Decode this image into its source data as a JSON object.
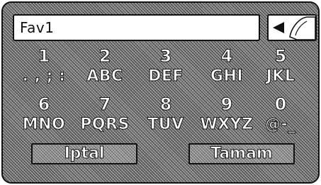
{
  "input": {
    "value": "Fav1"
  },
  "keypad": {
    "row1": [
      {
        "digit": "1",
        "letters": ". , ; :"
      },
      {
        "digit": "2",
        "letters": "ABC"
      },
      {
        "digit": "3",
        "letters": "DEF"
      },
      {
        "digit": "4",
        "letters": "GHI"
      },
      {
        "digit": "5",
        "letters": "JKL"
      }
    ],
    "row2": [
      {
        "digit": "6",
        "letters": "MNO"
      },
      {
        "digit": "7",
        "letters": "PQRS"
      },
      {
        "digit": "8",
        "letters": "TUV"
      },
      {
        "digit": "9",
        "letters": "WXYZ"
      },
      {
        "digit": "0",
        "letters": "@-_"
      }
    ]
  },
  "buttons": {
    "cancel_label": "Iptal",
    "ok_label": "Tamam"
  },
  "icons": {
    "backspace": "backspace-arrow-icon",
    "finger": "pointing-finger-icon"
  }
}
